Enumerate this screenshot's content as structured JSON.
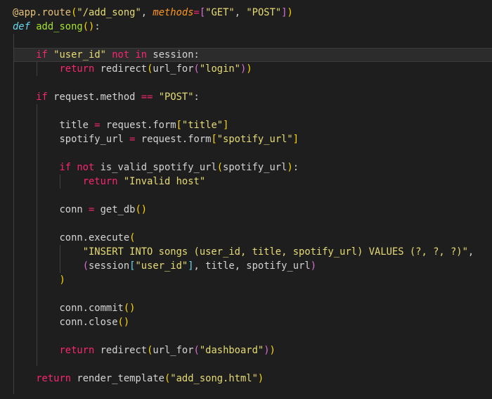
{
  "theme": {
    "background": "#1e1e1e",
    "colors": {
      "default": "#d4d4d4",
      "decorator": "#e5c07b",
      "string": "#e6db74",
      "keyword": "#f92672",
      "def": "#66d9ef",
      "param": "#fd971f",
      "bracket": "#66d9ef",
      "paren1": "#ffd700",
      "paren2": "#da70d6",
      "function": "#a6e22e"
    }
  },
  "code": {
    "lines": [
      {
        "tokens": [
          {
            "t": "@app.route",
            "c": "decorator"
          },
          {
            "t": "(",
            "c": "paren1"
          },
          {
            "t": "\"/add_song\"",
            "c": "string"
          },
          {
            "t": ", ",
            "c": "default"
          },
          {
            "t": "methods",
            "c": "param"
          },
          {
            "t": "=",
            "c": "keyword"
          },
          {
            "t": "[",
            "c": "paren2"
          },
          {
            "t": "\"GET\"",
            "c": "string"
          },
          {
            "t": ", ",
            "c": "default"
          },
          {
            "t": "\"POST\"",
            "c": "string"
          },
          {
            "t": "]",
            "c": "paren2"
          },
          {
            "t": ")",
            "c": "paren1"
          }
        ]
      },
      {
        "tokens": [
          {
            "t": "def",
            "c": "def"
          },
          {
            "t": " add_song",
            "c": "function"
          },
          {
            "t": "()",
            "c": "paren1"
          },
          {
            "t": ":",
            "c": "default"
          }
        ]
      },
      {
        "tokens": []
      },
      {
        "tokens": [
          {
            "t": "    ",
            "c": "default"
          },
          {
            "t": "if",
            "c": "keyword"
          },
          {
            "t": " ",
            "c": "default"
          },
          {
            "t": "\"user_id\"",
            "c": "string"
          },
          {
            "t": " ",
            "c": "default"
          },
          {
            "t": "not in",
            "c": "keyword"
          },
          {
            "t": " session:",
            "c": "default"
          }
        ]
      },
      {
        "tokens": [
          {
            "t": "        ",
            "c": "default"
          },
          {
            "t": "return",
            "c": "keyword"
          },
          {
            "t": " redirect",
            "c": "default"
          },
          {
            "t": "(",
            "c": "paren1"
          },
          {
            "t": "url_for",
            "c": "default"
          },
          {
            "t": "(",
            "c": "paren2"
          },
          {
            "t": "\"login\"",
            "c": "string"
          },
          {
            "t": ")",
            "c": "paren2"
          },
          {
            "t": ")",
            "c": "paren1"
          }
        ]
      },
      {
        "tokens": []
      },
      {
        "tokens": [
          {
            "t": "    ",
            "c": "default"
          },
          {
            "t": "if",
            "c": "keyword"
          },
          {
            "t": " request.method ",
            "c": "default"
          },
          {
            "t": "==",
            "c": "keyword"
          },
          {
            "t": " ",
            "c": "default"
          },
          {
            "t": "\"POST\"",
            "c": "string"
          },
          {
            "t": ":",
            "c": "default"
          }
        ]
      },
      {
        "tokens": []
      },
      {
        "tokens": [
          {
            "t": "        title ",
            "c": "default"
          },
          {
            "t": "=",
            "c": "keyword"
          },
          {
            "t": " request.form",
            "c": "default"
          },
          {
            "t": "[",
            "c": "paren1"
          },
          {
            "t": "\"title\"",
            "c": "string"
          },
          {
            "t": "]",
            "c": "paren1"
          }
        ]
      },
      {
        "tokens": [
          {
            "t": "        spotify_url ",
            "c": "default"
          },
          {
            "t": "=",
            "c": "keyword"
          },
          {
            "t": " request.form",
            "c": "default"
          },
          {
            "t": "[",
            "c": "paren1"
          },
          {
            "t": "\"spotify_url\"",
            "c": "string"
          },
          {
            "t": "]",
            "c": "paren1"
          }
        ]
      },
      {
        "tokens": []
      },
      {
        "tokens": [
          {
            "t": "        ",
            "c": "default"
          },
          {
            "t": "if not",
            "c": "keyword"
          },
          {
            "t": " is_valid_spotify_url",
            "c": "default"
          },
          {
            "t": "(",
            "c": "paren1"
          },
          {
            "t": "spotify_url",
            "c": "default"
          },
          {
            "t": ")",
            "c": "paren1"
          },
          {
            "t": ":",
            "c": "default"
          }
        ]
      },
      {
        "tokens": [
          {
            "t": "            ",
            "c": "default"
          },
          {
            "t": "return",
            "c": "keyword"
          },
          {
            "t": " ",
            "c": "default"
          },
          {
            "t": "\"Invalid host\"",
            "c": "string"
          }
        ]
      },
      {
        "tokens": []
      },
      {
        "tokens": [
          {
            "t": "        conn ",
            "c": "default"
          },
          {
            "t": "=",
            "c": "keyword"
          },
          {
            "t": " get_db",
            "c": "default"
          },
          {
            "t": "()",
            "c": "paren1"
          }
        ]
      },
      {
        "tokens": []
      },
      {
        "tokens": [
          {
            "t": "        conn.execute",
            "c": "default"
          },
          {
            "t": "(",
            "c": "paren1"
          }
        ]
      },
      {
        "tokens": [
          {
            "t": "            ",
            "c": "default"
          },
          {
            "t": "\"INSERT INTO songs (user_id, title, spotify_url) VALUES (?, ?, ?)\"",
            "c": "string"
          },
          {
            "t": ",",
            "c": "default"
          }
        ]
      },
      {
        "tokens": [
          {
            "t": "            ",
            "c": "default"
          },
          {
            "t": "(",
            "c": "paren2"
          },
          {
            "t": "session",
            "c": "default"
          },
          {
            "t": "[",
            "c": "bracket"
          },
          {
            "t": "\"user_id\"",
            "c": "string"
          },
          {
            "t": "]",
            "c": "bracket"
          },
          {
            "t": ", title, spotify_url",
            "c": "default"
          },
          {
            "t": ")",
            "c": "paren2"
          }
        ]
      },
      {
        "tokens": [
          {
            "t": "        ",
            "c": "default"
          },
          {
            "t": ")",
            "c": "paren1"
          }
        ]
      },
      {
        "tokens": []
      },
      {
        "tokens": [
          {
            "t": "        conn.commit",
            "c": "default"
          },
          {
            "t": "()",
            "c": "paren1"
          }
        ]
      },
      {
        "tokens": [
          {
            "t": "        conn.close",
            "c": "default"
          },
          {
            "t": "()",
            "c": "paren1"
          }
        ]
      },
      {
        "tokens": []
      },
      {
        "tokens": [
          {
            "t": "        ",
            "c": "default"
          },
          {
            "t": "return",
            "c": "keyword"
          },
          {
            "t": " redirect",
            "c": "default"
          },
          {
            "t": "(",
            "c": "paren1"
          },
          {
            "t": "url_for",
            "c": "default"
          },
          {
            "t": "(",
            "c": "paren2"
          },
          {
            "t": "\"dashboard\"",
            "c": "string"
          },
          {
            "t": ")",
            "c": "paren2"
          },
          {
            "t": ")",
            "c": "paren1"
          }
        ]
      },
      {
        "tokens": []
      },
      {
        "tokens": [
          {
            "t": "    ",
            "c": "default"
          },
          {
            "t": "return",
            "c": "keyword"
          },
          {
            "t": " render_template",
            "c": "default"
          },
          {
            "t": "(",
            "c": "paren1"
          },
          {
            "t": "\"add_song.html\"",
            "c": "string"
          },
          {
            "t": ")",
            "c": "paren1"
          }
        ]
      }
    ]
  }
}
